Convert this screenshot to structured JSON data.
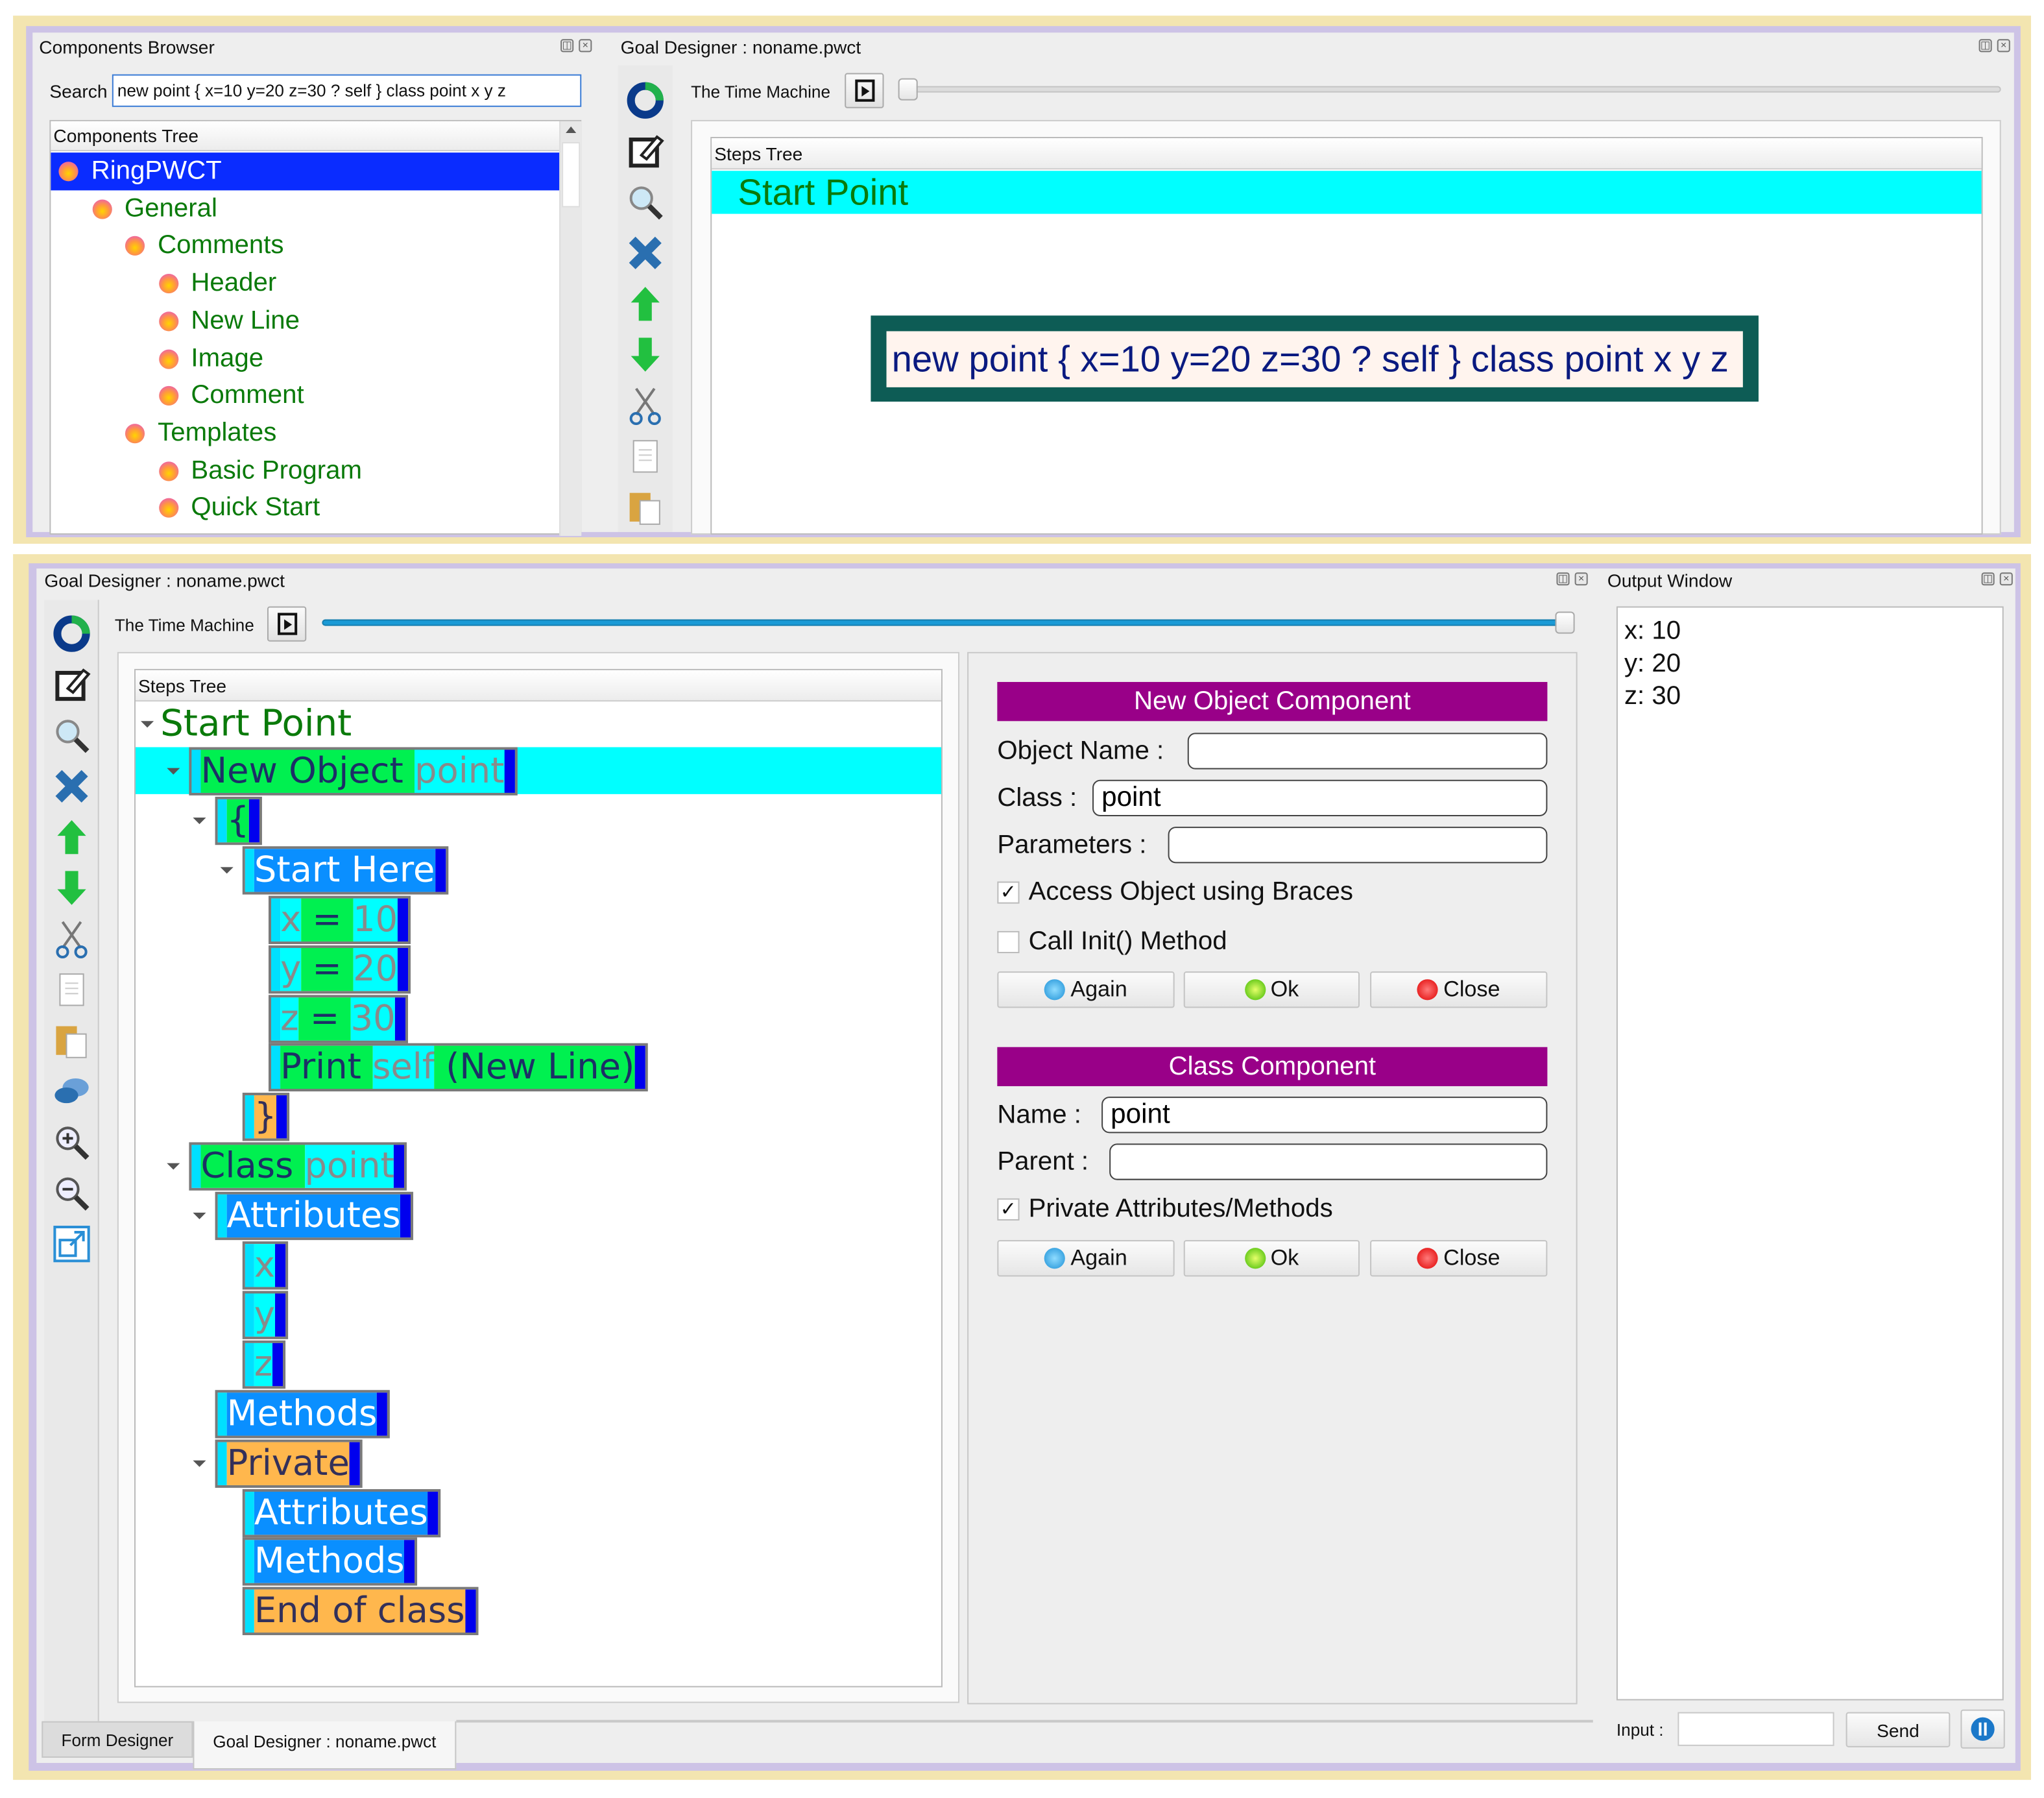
{
  "components_browser": {
    "title": "Components Browser",
    "search_label": "Search",
    "search_value": "new point { x=10 y=20 z=30 ? self } class point x y z",
    "tree_header": "Components Tree",
    "items": [
      {
        "label": "RingPWCT",
        "level": 0,
        "selected": true
      },
      {
        "label": "General",
        "level": 1
      },
      {
        "label": "Comments",
        "level": 2
      },
      {
        "label": "Header",
        "level": 3
      },
      {
        "label": "New Line",
        "level": 3
      },
      {
        "label": "Image",
        "level": 3
      },
      {
        "label": "Comment",
        "level": 3
      },
      {
        "label": "Templates",
        "level": 2
      },
      {
        "label": "Basic Program",
        "level": 3
      },
      {
        "label": "Quick Start",
        "level": 3
      }
    ]
  },
  "goal_designer_top": {
    "title": "Goal Designer : noname.pwct",
    "time_machine_label": "The Time Machine",
    "time_machine_position": 0,
    "steps_tree_header": "Steps Tree",
    "start_point": "Start Point",
    "search_popup_text": "new point { x=10 y=20 z=30 ? self } class point x y z"
  },
  "goal_designer": {
    "title": "Goal Designer : noname.pwct",
    "time_machine_label": "The Time Machine",
    "time_machine_position": 1,
    "steps_tree_header": "Steps Tree",
    "start_point": "Start Point",
    "nodes": [
      {
        "indent": 2,
        "toggle": true,
        "selected": true,
        "segments": [
          {
            "kind": "kw",
            "text": "New Object "
          },
          {
            "kind": "arg",
            "text": "point"
          }
        ]
      },
      {
        "indent": 3,
        "toggle": true,
        "segments": [
          {
            "kind": "kw",
            "text": "{"
          }
        ]
      },
      {
        "indent": 4,
        "toggle": true,
        "segments": [
          {
            "kind": "blue",
            "text": "Start Here"
          }
        ]
      },
      {
        "indent": 5,
        "segments": [
          {
            "kind": "arg",
            "text": "x"
          },
          {
            "kind": "kw",
            "text": " = "
          },
          {
            "kind": "arg",
            "text": "10"
          }
        ]
      },
      {
        "indent": 5,
        "segments": [
          {
            "kind": "arg",
            "text": "y"
          },
          {
            "kind": "kw",
            "text": " = "
          },
          {
            "kind": "arg",
            "text": "20"
          }
        ]
      },
      {
        "indent": 5,
        "segments": [
          {
            "kind": "arg",
            "text": "z"
          },
          {
            "kind": "kw",
            "text": " = "
          },
          {
            "kind": "arg",
            "text": "30"
          }
        ]
      },
      {
        "indent": 5,
        "segments": [
          {
            "kind": "kw",
            "text": "Print "
          },
          {
            "kind": "arg",
            "text": "self"
          },
          {
            "kind": "kw",
            "text": " (New Line)"
          }
        ]
      },
      {
        "indent": 4,
        "segments": [
          {
            "kind": "orange",
            "text": "}"
          }
        ]
      },
      {
        "indent": 2,
        "toggle": true,
        "segments": [
          {
            "kind": "kw",
            "text": "Class "
          },
          {
            "kind": "arg",
            "text": "point"
          }
        ]
      },
      {
        "indent": 3,
        "toggle": true,
        "segments": [
          {
            "kind": "blue",
            "text": "Attributes"
          }
        ]
      },
      {
        "indent": 4,
        "segments": [
          {
            "kind": "arg",
            "text": "x"
          }
        ]
      },
      {
        "indent": 4,
        "segments": [
          {
            "kind": "arg",
            "text": "y"
          }
        ]
      },
      {
        "indent": 4,
        "segments": [
          {
            "kind": "arg",
            "text": "z"
          }
        ]
      },
      {
        "indent": 3,
        "segments": [
          {
            "kind": "blue",
            "text": "Methods"
          }
        ]
      },
      {
        "indent": 3,
        "toggle": true,
        "segments": [
          {
            "kind": "orange",
            "text": "Private"
          }
        ]
      },
      {
        "indent": 4,
        "segments": [
          {
            "kind": "blue",
            "text": "Attributes"
          }
        ]
      },
      {
        "indent": 4,
        "segments": [
          {
            "kind": "blue",
            "text": "Methods"
          }
        ]
      },
      {
        "indent": 4,
        "segments": [
          {
            "kind": "orange",
            "text": "End of class"
          }
        ]
      }
    ]
  },
  "new_object_component": {
    "title": "New Object Component",
    "object_name_label": "Object Name :",
    "object_name_value": "",
    "class_label": "Class :",
    "class_value": "point",
    "parameters_label": "Parameters :",
    "parameters_value": "",
    "access_braces_label": "Access Object using Braces",
    "access_braces_checked": true,
    "call_init_label": "Call Init() Method",
    "call_init_checked": false,
    "again": "Again",
    "ok": "Ok",
    "close": "Close"
  },
  "class_component": {
    "title": "Class Component",
    "name_label": "Name :",
    "name_value": "point",
    "parent_label": "Parent :",
    "parent_value": "",
    "private_label": "Private Attributes/Methods",
    "private_checked": true,
    "again": "Again",
    "ok": "Ok",
    "close": "Close"
  },
  "output_window": {
    "title": "Output Window",
    "lines": [
      "x: 10",
      "y: 20",
      "z: 30"
    ],
    "input_label": "Input :",
    "input_value": "",
    "send": "Send"
  },
  "tabs": [
    {
      "label": "Form Designer",
      "active": false
    },
    {
      "label": "Goal Designer : noname.pwct",
      "active": true
    }
  ],
  "colors": {
    "accent_purple": "#990088",
    "selection_blue": "#0a2cff",
    "cyan": "#00ffff",
    "frame_yellow": "#f3e5b0",
    "frame_lavender": "#cdc3e6"
  }
}
